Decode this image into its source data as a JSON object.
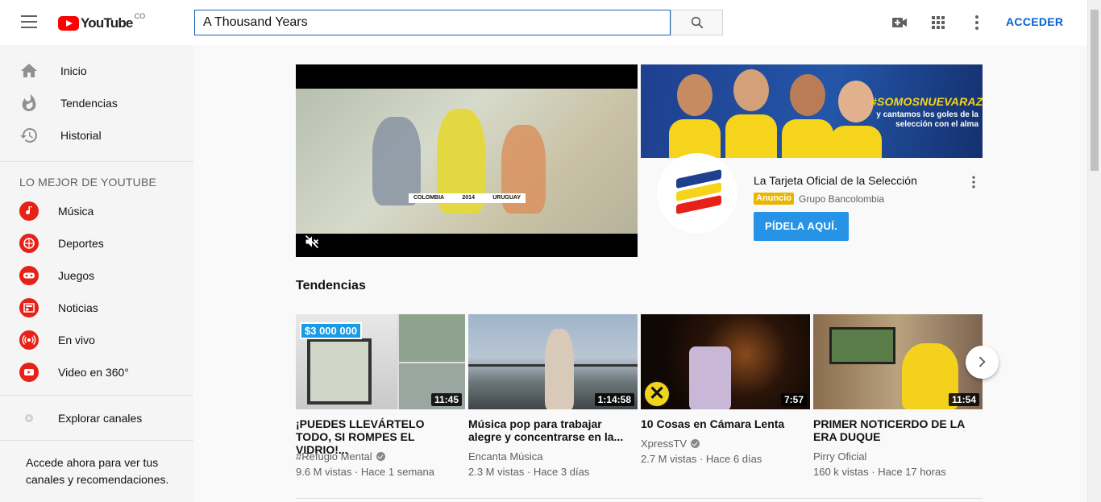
{
  "header": {
    "logo_text": "YouTube",
    "logo_country": "CO",
    "search_value": "A Thousand Years",
    "signin_label": "ACCEDER",
    "icons": [
      "menu-icon",
      "search-icon",
      "create-video-icon",
      "apps-grid-icon",
      "more-vert-icon"
    ]
  },
  "sidebar": {
    "main_items": [
      {
        "label": "Inicio",
        "icon": "home-icon"
      },
      {
        "label": "Tendencias",
        "icon": "trending-icon"
      },
      {
        "label": "Historial",
        "icon": "history-icon"
      }
    ],
    "section_title": "LO MEJOR DE YOUTUBE",
    "categories": [
      {
        "label": "Música",
        "icon": "music-icon"
      },
      {
        "label": "Deportes",
        "icon": "sports-icon"
      },
      {
        "label": "Juegos",
        "icon": "gaming-icon"
      },
      {
        "label": "Noticias",
        "icon": "news-icon"
      },
      {
        "label": "En vivo",
        "icon": "live-icon"
      },
      {
        "label": "Video en 360°",
        "icon": "video-360-icon"
      }
    ],
    "explore_label": "Explorar canales",
    "signin_prompt": "Accede ahora para ver tus canales y recomendaciones."
  },
  "player": {
    "scorebug_home": "COLOMBIA",
    "scorebug_year": "2014",
    "scorebug_away": "URUGUAY",
    "muted": true
  },
  "ad": {
    "hashtag": "#SOMOSNUEVARAZA",
    "subtitle": "y cantamos los goles de la selección con el alma",
    "title": "La Tarjeta Oficial de la Selección",
    "badge": "Anuncio",
    "advertiser": "Grupo Bancolombia",
    "cta_label": "PÍDELA AQUÍ.",
    "colors": {
      "cta": "#2793e6",
      "badge": "#e9b500",
      "banner": "#2456a8"
    }
  },
  "trending": {
    "heading": "Tendencias",
    "videos": [
      {
        "title": "¡PUEDES LLEVÁRTELO TODO, SI ROMPES EL VIDRIO!...",
        "channel": "#Refugio Mental",
        "verified": true,
        "views": "9.6 M vistas",
        "age": "Hace 1 semana",
        "duration": "11:45",
        "thumb_overlay": "$3 000 000"
      },
      {
        "title": "Música pop para trabajar alegre y concentrarse en la...",
        "channel": "Encanta Música",
        "verified": false,
        "views": "2.3 M vistas",
        "age": "Hace 3 días",
        "duration": "1:14:58"
      },
      {
        "title": "10 Cosas en Cámara Lenta",
        "channel": "XpressTV",
        "verified": true,
        "views": "2.7 M vistas",
        "age": "Hace 6 días",
        "duration": "7:57"
      },
      {
        "title": "PRIMER NOTICERDO DE LA ERA DUQUE",
        "channel": "Pirry Oficial",
        "verified": false,
        "views": "160 k vistas",
        "age": "Hace 17 horas",
        "duration": "11:54"
      }
    ]
  }
}
